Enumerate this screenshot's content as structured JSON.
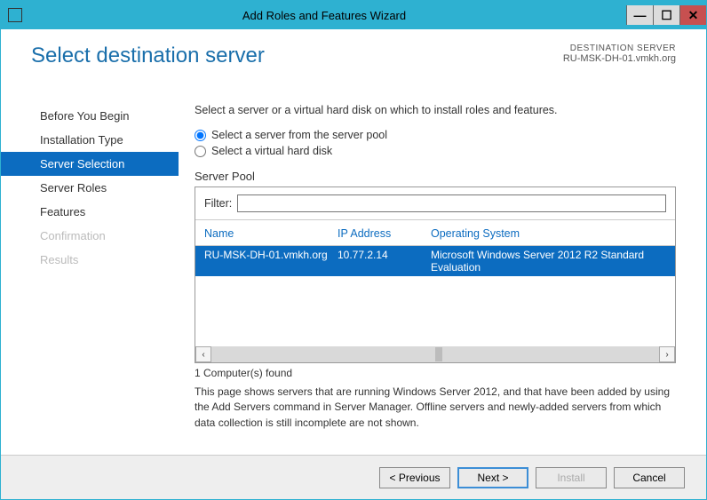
{
  "titlebar": {
    "title": "Add Roles and Features Wizard"
  },
  "header": {
    "page_title": "Select destination server",
    "dest_label": "DESTINATION SERVER",
    "dest_value": "RU-MSK-DH-01.vmkh.org"
  },
  "sidebar": {
    "items": [
      {
        "label": "Before You Begin",
        "state": "normal"
      },
      {
        "label": "Installation Type",
        "state": "normal"
      },
      {
        "label": "Server Selection",
        "state": "selected"
      },
      {
        "label": "Server Roles",
        "state": "normal"
      },
      {
        "label": "Features",
        "state": "normal"
      },
      {
        "label": "Confirmation",
        "state": "disabled"
      },
      {
        "label": "Results",
        "state": "disabled"
      }
    ]
  },
  "main": {
    "intro": "Select a server or a virtual hard disk on which to install roles and features.",
    "radio1": "Select a server from the server pool",
    "radio2": "Select a virtual hard disk",
    "pool_label": "Server Pool",
    "filter_label": "Filter:",
    "filter_value": "",
    "columns": {
      "name": "Name",
      "ip": "IP Address",
      "os": "Operating System"
    },
    "rows": [
      {
        "name": "RU-MSK-DH-01.vmkh.org",
        "ip": "10.77.2.14",
        "os": "Microsoft Windows Server 2012 R2 Standard Evaluation"
      }
    ],
    "found": "1 Computer(s) found",
    "note": "This page shows servers that are running Windows Server 2012, and that have been added by using the Add Servers command in Server Manager. Offline servers and newly-added servers from which data collection is still incomplete are not shown."
  },
  "footer": {
    "previous": "< Previous",
    "next": "Next >",
    "install": "Install",
    "cancel": "Cancel"
  }
}
